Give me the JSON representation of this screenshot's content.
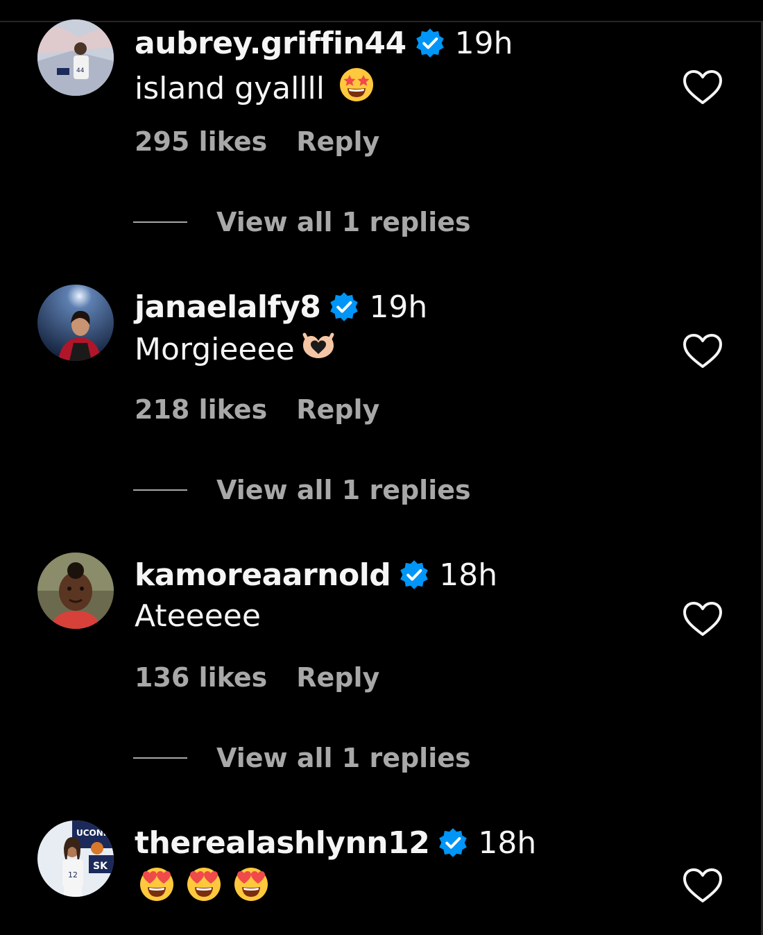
{
  "comments": [
    {
      "username": "aubrey.griffin44",
      "time": "19h",
      "text": "island gyallll",
      "emoji": "star-struck",
      "likes": "295 likes",
      "reply_label": "Reply",
      "view_replies": "View all 1 replies"
    },
    {
      "username": "janaelalfy8",
      "time": "19h",
      "text": "Morgieeee",
      "emoji": "heart-hands",
      "likes": "218 likes",
      "reply_label": "Reply",
      "view_replies": "View all 1 replies"
    },
    {
      "username": "kamoreaarnold",
      "time": "18h",
      "text": "Ateeeee",
      "likes": "136 likes",
      "reply_label": "Reply",
      "view_replies": "View all 1 replies"
    },
    {
      "username": "therealashlynn12",
      "time": "18h",
      "text": "",
      "emoji": "heart-eyes x3"
    }
  ],
  "colors": {
    "background": "#000000",
    "primary_text": "#f5f5f5",
    "secondary_text": "#a8a8a8",
    "verified_badge": "#0095f6",
    "emoji_yellow": "#ffc83d",
    "emoji_heart": "#f04a4a"
  },
  "icons": [
    "verified-badge-icon",
    "heart-outline-icon",
    "star-struck-emoji",
    "heart-hands-emoji",
    "heart-eyes-emoji"
  ]
}
